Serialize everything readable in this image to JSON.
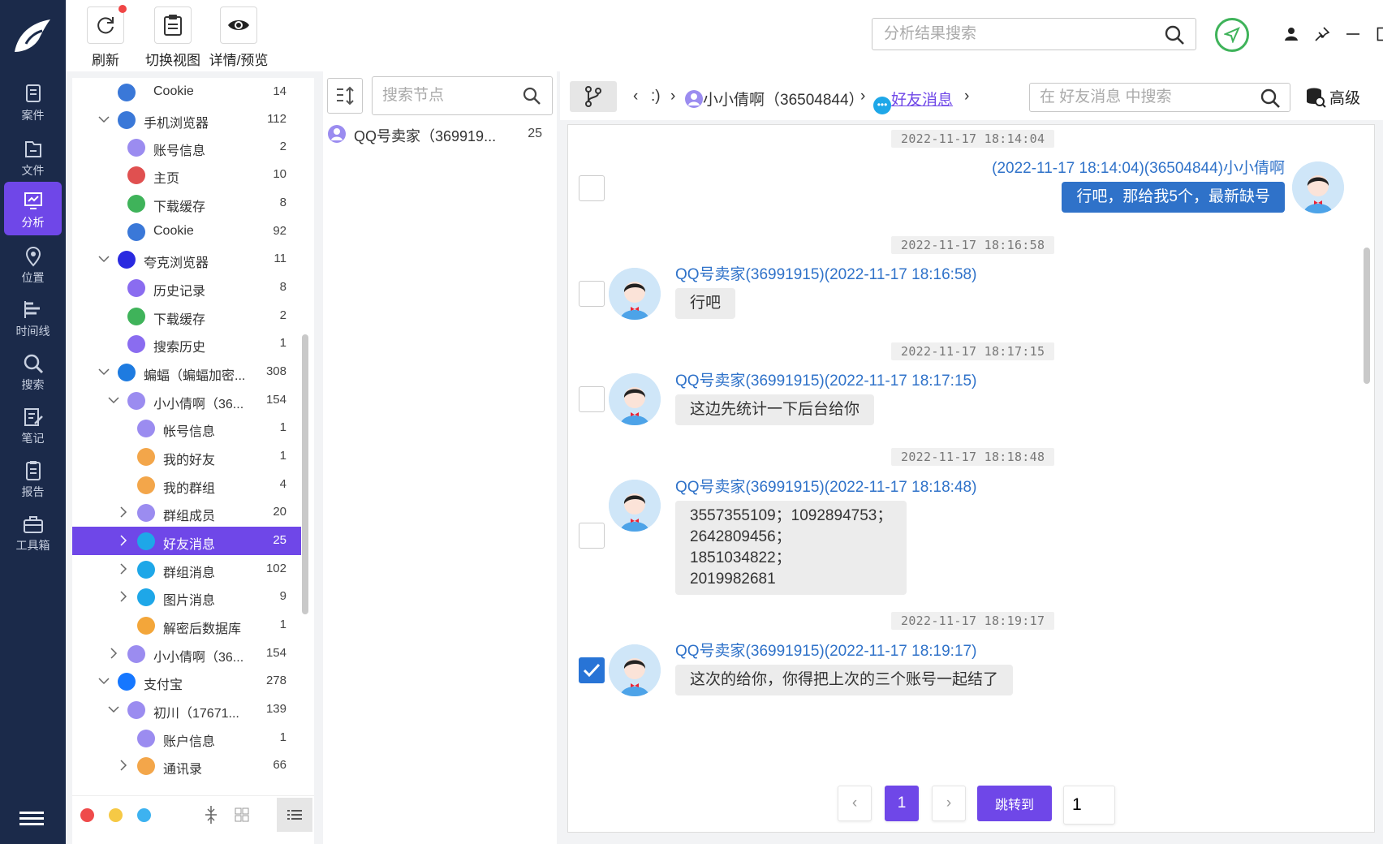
{
  "nav": {
    "items": [
      {
        "label": "案件",
        "icon": "case-icon"
      },
      {
        "label": "文件",
        "icon": "folder-icon"
      },
      {
        "label": "分析",
        "icon": "analysis-icon"
      },
      {
        "label": "位置",
        "icon": "location-icon"
      },
      {
        "label": "时间线",
        "icon": "timeline-icon"
      },
      {
        "label": "搜索",
        "icon": "search-icon"
      },
      {
        "label": "笔记",
        "icon": "note-icon"
      },
      {
        "label": "报告",
        "icon": "report-icon"
      },
      {
        "label": "工具箱",
        "icon": "toolbox-icon"
      }
    ],
    "active_index": 2
  },
  "toolbar": {
    "refresh_label": "刷新",
    "switch_view_label": "切换视图",
    "details_label": "详情/预览",
    "search_placeholder": "分析结果搜索"
  },
  "tree": {
    "rows": [
      {
        "label": "Cookie",
        "count": "14",
        "icon": "browser-globe-icon",
        "color": "#3a78d8"
      },
      {
        "label": "手机浏览器",
        "count": "112",
        "icon": "browser-globe-icon",
        "color": "#3a78d8"
      },
      {
        "label": "账号信息",
        "count": "2",
        "icon": "account-icon",
        "color": "#9b8cf0"
      },
      {
        "label": "主页",
        "count": "10",
        "icon": "home-icon",
        "color": "#e05050"
      },
      {
        "label": "下载缓存",
        "count": "8",
        "icon": "download-icon",
        "color": "#3fb35a"
      },
      {
        "label": "Cookie",
        "count": "92",
        "icon": "browser-globe-icon",
        "color": "#3a78d8"
      },
      {
        "label": "夸克浏览器",
        "count": "11",
        "icon": "quark-browser-icon",
        "color": "#2a2ae0"
      },
      {
        "label": "历史记录",
        "count": "8",
        "icon": "history-icon",
        "color": "#8a6cf0"
      },
      {
        "label": "下载缓存",
        "count": "2",
        "icon": "download-icon",
        "color": "#3fb35a"
      },
      {
        "label": "搜索历史",
        "count": "1",
        "icon": "history-icon",
        "color": "#8a6cf0"
      },
      {
        "label": "蝙蝠（蝙蝠加密...",
        "count": "308",
        "icon": "bat-app-icon",
        "color": "#1e7be0"
      },
      {
        "label": "小小倩啊（36...",
        "count": "154",
        "icon": "account-icon",
        "color": "#9b8cf0"
      },
      {
        "label": "帐号信息",
        "count": "1",
        "icon": "account-icon",
        "color": "#9b8cf0"
      },
      {
        "label": "我的好友",
        "count": "1",
        "icon": "contacts-icon",
        "color": "#f3a64a"
      },
      {
        "label": "我的群组",
        "count": "4",
        "icon": "group-card-icon",
        "color": "#f3a64a"
      },
      {
        "label": "群组成员",
        "count": "20",
        "icon": "account-icon",
        "color": "#9b8cf0"
      },
      {
        "label": "好友消息",
        "count": "25",
        "icon": "chat-bubble-icon",
        "color": "#1ea7e8"
      },
      {
        "label": "群组消息",
        "count": "102",
        "icon": "chat-bubble-icon",
        "color": "#1ea7e8"
      },
      {
        "label": "图片消息",
        "count": "9",
        "icon": "chat-bubble-icon",
        "color": "#1ea7e8"
      },
      {
        "label": "解密后数据库",
        "count": "1",
        "icon": "database-icon",
        "color": "#f3a63a"
      },
      {
        "label": "小小倩啊（36...",
        "count": "154",
        "icon": "account-icon",
        "color": "#9b8cf0"
      },
      {
        "label": "支付宝",
        "count": "278",
        "icon": "alipay-icon",
        "color": "#1677ff"
      },
      {
        "label": "初川（17671...",
        "count": "139",
        "icon": "account-icon",
        "color": "#9b8cf0"
      },
      {
        "label": "账户信息",
        "count": "1",
        "icon": "account-icon",
        "color": "#9b8cf0"
      },
      {
        "label": "通讯录",
        "count": "66",
        "icon": "contacts-icon",
        "color": "#f3a64a"
      }
    ]
  },
  "nodes": {
    "search_placeholder": "搜索节点",
    "items": [
      {
        "label": "QQ号卖家（369919...",
        "count": "25"
      }
    ]
  },
  "breadcrumb": {
    "part1": ":)",
    "part2": "小小倩啊（36504844）",
    "part3": "好友消息"
  },
  "chat_search": {
    "placeholder": "在 好友消息 中搜索",
    "advanced_label": "高级"
  },
  "messages": [
    {
      "time": "2022-11-17 18:14:04",
      "sender": "(2022-11-17 18:14:04)(36504844)小小倩啊",
      "lines": [
        "行吧，那给我5个，最新缺号"
      ],
      "mine": true,
      "checked": false
    },
    {
      "time": "2022-11-17 18:16:58",
      "sender": "QQ号卖家(36991915)(2022-11-17 18:16:58)",
      "lines": [
        "行吧"
      ],
      "mine": false,
      "checked": false
    },
    {
      "time": "2022-11-17 18:17:15",
      "sender": "QQ号卖家(36991915)(2022-11-17 18:17:15)",
      "lines": [
        "这边先统计一下后台给你"
      ],
      "mine": false,
      "checked": false
    },
    {
      "time": "2022-11-17 18:18:48",
      "sender": "QQ号卖家(36991915)(2022-11-17 18:18:48)",
      "lines": [
        "3557355109；1092894753；",
        "2642809456；",
        "1851034822；",
        "2019982681"
      ],
      "mine": false,
      "checked": false
    },
    {
      "time": "2022-11-17 18:19:17",
      "sender": "QQ号卖家(36991915)(2022-11-17 18:19:17)",
      "lines": [
        "这次的给你，你得把上次的三个账号一起结了"
      ],
      "mine": false,
      "checked": true
    }
  ],
  "pager": {
    "current": "1",
    "jump_label": "跳转到",
    "jump_value": "1"
  },
  "colors": {
    "accent": "#6f47e8",
    "nav_bg": "#1b2a4a",
    "link": "#2f72c9",
    "send_green": "#3fb35a"
  }
}
